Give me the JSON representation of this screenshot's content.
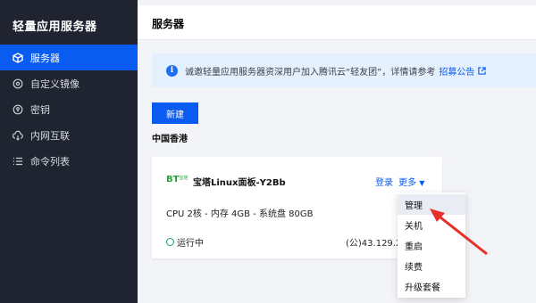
{
  "sidebar": {
    "brand": "轻量应用服务器",
    "items": [
      {
        "label": "服务器",
        "icon": "cube-icon",
        "active": true
      },
      {
        "label": "自定义镜像",
        "icon": "disc-icon",
        "active": false
      },
      {
        "label": "密钥",
        "icon": "key-icon",
        "active": false
      },
      {
        "label": "内网互联",
        "icon": "cloud-link-icon",
        "active": false
      },
      {
        "label": "命令列表",
        "icon": "list-icon",
        "active": false
      }
    ]
  },
  "header": {
    "title": "服务器"
  },
  "notice": {
    "text": "诚邀轻量应用服务器资深用户加入腾讯云“轻友团”，详情请参考",
    "link": "招募公告",
    "icon": "info-icon"
  },
  "actions": {
    "new_label": "新建"
  },
  "region": "中国香港",
  "card": {
    "logo_text": "BT",
    "logo_small": "宝塔",
    "name": "宝塔Linux面板-Y2Bb",
    "login": "登录",
    "more": "更多",
    "specs": "CPU 2核 - 内存 4GB - 系统盘 80GB",
    "status": "运行中",
    "ip": "(公)43.129.20"
  },
  "dropdown": {
    "items": [
      "管理",
      "关机",
      "重启",
      "续费",
      "升级套餐"
    ]
  },
  "colors": {
    "accent": "#0a5bf0",
    "sidebar": "#1f2430",
    "status": "#18a058",
    "annotation": "#e8302a"
  }
}
